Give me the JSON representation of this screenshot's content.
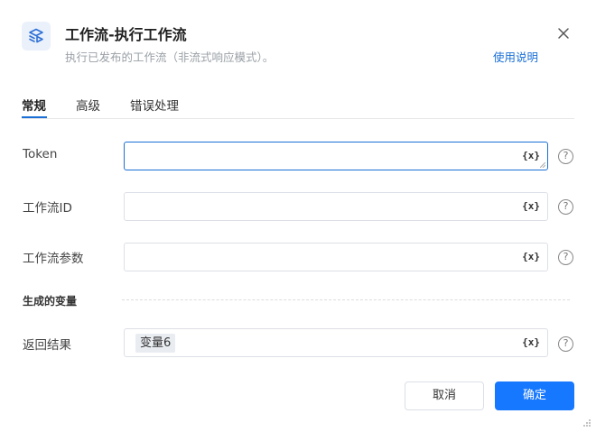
{
  "dialog": {
    "title": "工作流-执行工作流",
    "subtitle": "执行已发布的工作流（非流式响应模式）。",
    "help_link": "使用说明"
  },
  "tabs": [
    {
      "label": "常规",
      "active": true
    },
    {
      "label": "高级",
      "active": false
    },
    {
      "label": "错误处理",
      "active": false
    }
  ],
  "fields": {
    "token": {
      "label": "Token",
      "value": "",
      "var_button": "{x}"
    },
    "workflow_id": {
      "label": "工作流ID",
      "value": "",
      "var_button": "{x}"
    },
    "workflow_params": {
      "label": "工作流参数",
      "value": "",
      "var_button": "{x}"
    }
  },
  "output_section": {
    "label": "生成的变量",
    "return_result": {
      "label": "返回结果",
      "variable": "变量6",
      "var_button": "{x}"
    }
  },
  "help_icon_text": "?",
  "buttons": {
    "cancel": "取消",
    "confirm": "确定"
  },
  "colors": {
    "accent": "#1677ff",
    "link": "#1a6fd6",
    "focus_border": "#1a6fd6"
  }
}
